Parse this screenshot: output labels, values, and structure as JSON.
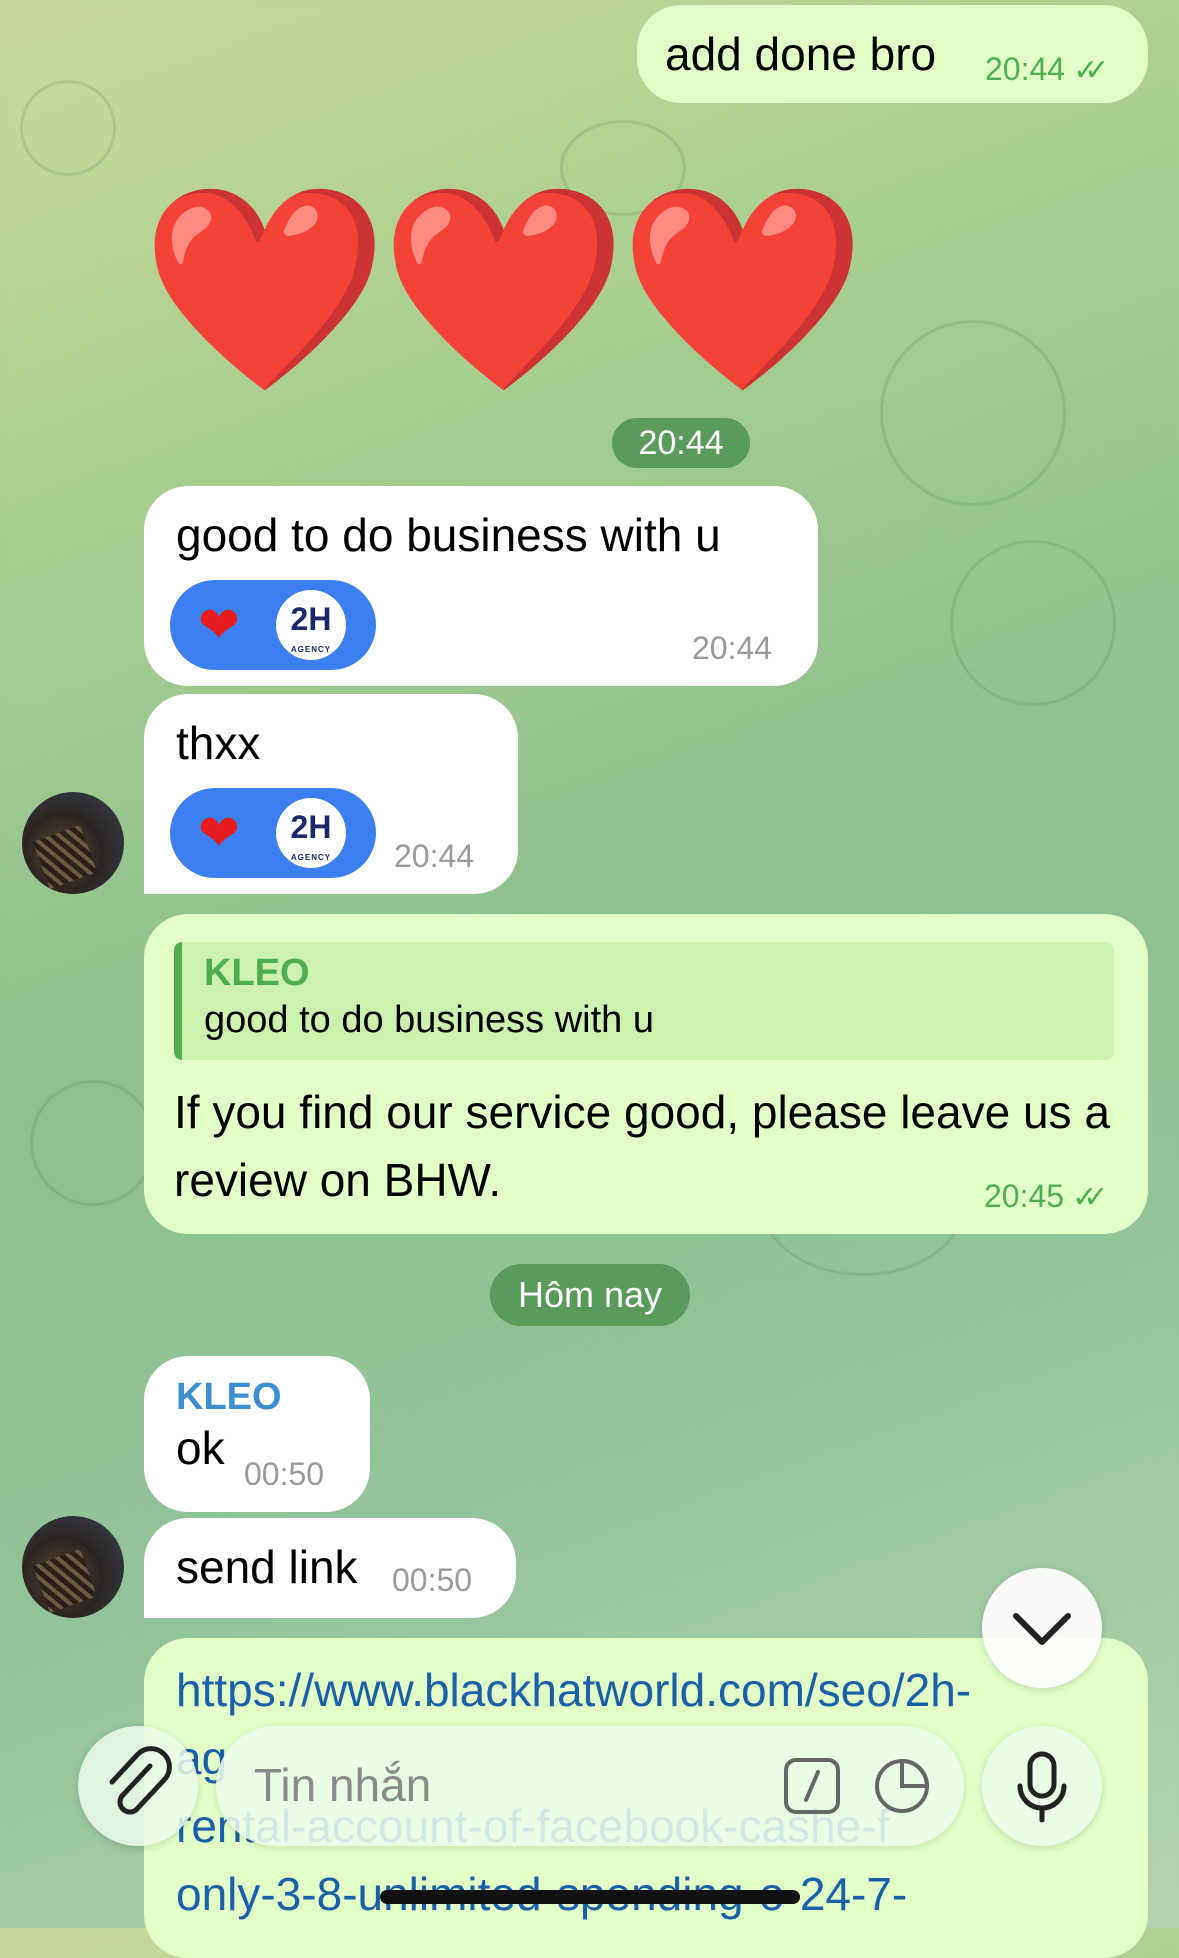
{
  "messages": [
    {
      "id": "m1",
      "direction": "outgoing",
      "text": "add done bro",
      "time": "20:44",
      "read": "✓✓"
    },
    {
      "id": "m2",
      "direction": "outgoing",
      "emoji": "❤️❤️❤️"
    },
    {
      "id": "m3",
      "direction": "incoming",
      "text": "good to do business with u",
      "time": "20:44"
    },
    {
      "id": "m4",
      "direction": "incoming",
      "text": "thxx",
      "time": "20:44"
    },
    {
      "id": "m5",
      "direction": "outgoing",
      "reply_sender": "KLEO",
      "reply_text": "good to do business with u",
      "text": "If you find our service good, please leave us a review on BHW.",
      "time": "20:45",
      "read": "✓✓"
    },
    {
      "id": "m6",
      "direction": "incoming",
      "sender": "KLEO",
      "text": "ok",
      "time": "00:50"
    },
    {
      "id": "m7",
      "direction": "incoming",
      "text": "send link",
      "time": "00:50"
    },
    {
      "id": "m8",
      "direction": "outgoing",
      "link_lines": [
        "https://www.blackhatworld.com/seo/2h-",
        "ag",
        "rental-account-of-facebook-cashe-f",
        "only-3-8-unlimited-spending-o-24-7-"
      ]
    }
  ],
  "date_pills": {
    "time_pill": "20:44",
    "today_pill": "Hôm nay"
  },
  "reactions": {
    "heart": "❤",
    "logo_text": "2H",
    "logo_sub": "AGENCY",
    "colors": {
      "pill": "#3b7ff0"
    }
  },
  "composer": {
    "placeholder": "Tin nhắn"
  },
  "icons": {
    "attach": "paperclip-icon",
    "commands": "slash-command-icon",
    "sticker": "sticker-icon",
    "mic": "microphone-icon",
    "scroll": "chevron-down-icon"
  },
  "colors": {
    "outgoing_bubble": "#e1ffc7",
    "incoming_bubble": "#ffffff",
    "accent": "#4fae4e",
    "link": "#1b5fa8"
  }
}
